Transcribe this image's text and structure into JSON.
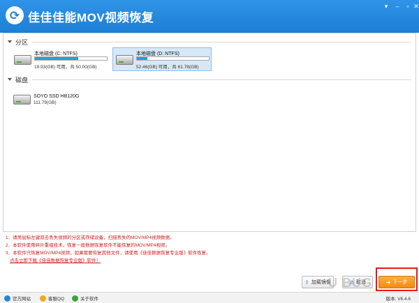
{
  "window": {
    "title": "佳佳佳能MOV视频恢复",
    "controls": {
      "dropdown": "▾",
      "minimize": "–",
      "maximize": "□",
      "close": "✕"
    }
  },
  "partitions": {
    "label": "分区",
    "items": [
      {
        "name": "本地磁盘 (C: NTFS)",
        "info": "19.93(GB) 可用，共 50.00(GB)",
        "used_fraction": 0.6,
        "selected": false
      },
      {
        "name": "本地磁盘 (D: NTFS)",
        "info": "52.46(GB) 可用，共 61.78(GB)",
        "used_fraction": 0.15,
        "selected": true
      }
    ]
  },
  "disks": {
    "label": "磁盘",
    "items": [
      {
        "name": "SOYO SSD HB120G",
        "info": "111.79(GB)"
      }
    ]
  },
  "notes": [
    "1．请用鼠标左键双击丢失视频的分区或存储设备，扫描丢失的MOV/MP4视频数据。",
    "2．本软件使用碎片重组技术，恢复一般数据恢复软件不能恢复的MOV/MP4视频。",
    "3．本软件只恢复MOV/MP4视频，如果需要恢复其他文件，请使用《佳佳数据恢复专业版》软件恢复。"
  ],
  "note_link": "点击立即下载《佳佳数据恢复专业版》软件！",
  "buttons": {
    "load_image": "加载镜像",
    "cancel": "取消",
    "next": "下一步"
  },
  "statusbar": {
    "website": "官方网站",
    "qq": "客服QQ",
    "about": "关于软件",
    "version": "版本: V6.4.6"
  },
  "watermark": "U BUG",
  "colors": {
    "accent": "#1d7fd6",
    "warning_text": "#d11b1b",
    "next_button": "#f28a10"
  }
}
